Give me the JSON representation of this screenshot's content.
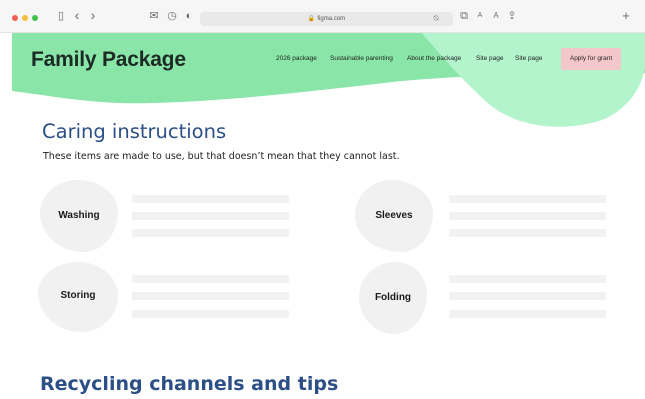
{
  "browser": {
    "url": "figma.com",
    "lock_glyph": "🔒",
    "tools": {
      "sidebar": "▯",
      "back": "‹",
      "forward": "›",
      "mail": "✉",
      "history": "◷",
      "shield": "◐",
      "reader": "⍉",
      "tabs": "⧉",
      "font_small": "A",
      "font_large": "A",
      "share": "⇪",
      "new_tab": "+"
    },
    "traffic_colors": [
      "#ee5f57",
      "#f6bd3b",
      "#3fc14d"
    ]
  },
  "header": {
    "brand": "Family Package",
    "nav": [
      "2026 package",
      "Sustainable parenting",
      "About the package",
      "Site page",
      "Site page"
    ],
    "grant_button": "Apply for grant",
    "colors": {
      "primary": "#8ae6a8",
      "secondary": "#b3f4cd",
      "button": "#f4c8cb"
    }
  },
  "care": {
    "title": "Caring instructions",
    "subtitle": "These items are made to use, but that doesn’t mean that they cannot last.",
    "items": [
      {
        "label": "Washing"
      },
      {
        "label": "Sleeves"
      },
      {
        "label": "Storing"
      },
      {
        "label": "Folding"
      }
    ]
  },
  "recycling": {
    "title": "Recycling channels and tips"
  }
}
